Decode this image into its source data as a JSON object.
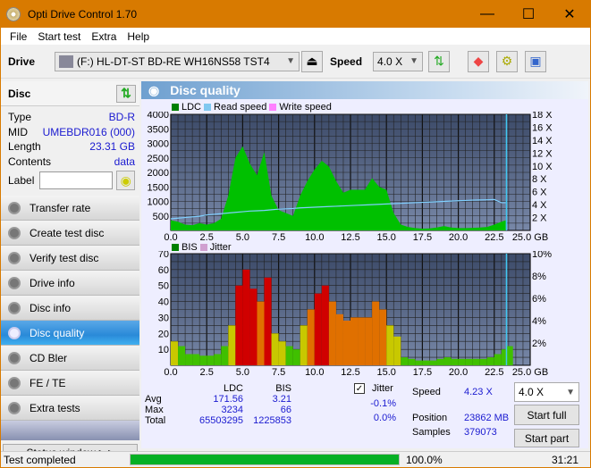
{
  "window": {
    "title": "Opti Drive Control 1.70",
    "min": "—",
    "max": "☐",
    "close": "✕"
  },
  "menu": [
    "File",
    "Start test",
    "Extra",
    "Help"
  ],
  "toolbar": {
    "drive_label": "Drive",
    "drive_value": "(F:)  HL-DT-ST BD-RE  WH16NS58 TST4",
    "speed_label": "Speed",
    "speed_value": "4.0 X"
  },
  "disc": {
    "header": "Disc",
    "rows": [
      {
        "k": "Type",
        "v": "BD-R"
      },
      {
        "k": "MID",
        "v": "UMEBDR016 (000)"
      },
      {
        "k": "Length",
        "v": "23.31 GB"
      },
      {
        "k": "Contents",
        "v": "data"
      }
    ],
    "label_key": "Label",
    "label_value": ""
  },
  "nav": [
    "Transfer rate",
    "Create test disc",
    "Verify test disc",
    "Drive info",
    "Disc info",
    "Disc quality",
    "CD Bler",
    "FE / TE",
    "Extra tests"
  ],
  "nav_active": 5,
  "status_window": "Status window > >",
  "main_title": "Disc quality",
  "chart_data": [
    {
      "type": "area",
      "title": "LDC",
      "legend": [
        "LDC",
        "Read speed",
        "Write speed"
      ],
      "legend_colors": [
        "#008000",
        "#80c8f0",
        "#ff80ff"
      ],
      "xlabel": "GB",
      "x_ticks": [
        "0.0",
        "2.5",
        "5.0",
        "7.5",
        "10.0",
        "12.5",
        "15.0",
        "17.5",
        "20.0",
        "22.5",
        "25.0 GB"
      ],
      "y_ticks": [
        "500",
        "1000",
        "1500",
        "2000",
        "2500",
        "3000",
        "3500",
        "4000"
      ],
      "y2_ticks": [
        "2 X",
        "4 X",
        "6 X",
        "8 X",
        "10 X",
        "12 X",
        "14 X",
        "16 X",
        "18 X"
      ],
      "xlim": [
        0,
        25
      ],
      "ylim": [
        0,
        4000
      ],
      "y2lim": [
        0,
        18
      ],
      "x": [
        0,
        0.5,
        1,
        1.5,
        2,
        2.5,
        3,
        3.5,
        4,
        4.5,
        5,
        5.5,
        6,
        6.5,
        7,
        7.5,
        8,
        8.5,
        9,
        9.5,
        10,
        10.5,
        11,
        11.5,
        12,
        12.5,
        13,
        13.5,
        14,
        14.5,
        15,
        15.5,
        16,
        16.5,
        17,
        17.5,
        18,
        18.5,
        19,
        19.5,
        20,
        20.5,
        21,
        21.5,
        22,
        22.5,
        23,
        23.3
      ],
      "ldc": [
        350,
        300,
        200,
        180,
        250,
        200,
        250,
        400,
        1200,
        2500,
        2900,
        2300,
        1900,
        2700,
        1200,
        700,
        600,
        500,
        1200,
        1700,
        2100,
        2400,
        2200,
        1700,
        1300,
        1400,
        1400,
        1400,
        1800,
        1500,
        1400,
        600,
        200,
        120,
        80,
        60,
        70,
        100,
        150,
        100,
        80,
        80,
        90,
        100,
        120,
        200,
        300,
        350
      ],
      "read_speed": [
        1.8,
        1.9,
        2.0,
        2.1,
        2.2,
        2.4,
        2.5,
        2.6,
        2.7,
        2.8,
        2.9,
        3.0,
        3.05,
        3.1,
        3.2,
        3.3,
        3.35,
        3.4,
        3.5,
        3.55,
        3.6,
        3.65,
        3.7,
        3.75,
        3.8,
        3.85,
        3.9,
        3.95,
        4.0,
        4.05,
        4.1,
        4.15,
        4.2,
        4.25,
        4.3,
        4.35,
        4.4,
        4.45,
        4.5,
        4.55,
        4.6,
        4.65,
        4.7,
        4.72,
        4.75,
        4.8,
        4.3,
        4.3
      ]
    },
    {
      "type": "bar",
      "title": "BIS",
      "legend": [
        "BIS",
        "Jitter"
      ],
      "legend_colors": [
        "#008000",
        "#d0a0d0"
      ],
      "xlabel": "GB",
      "x_ticks": [
        "0.0",
        "2.5",
        "5.0",
        "7.5",
        "10.0",
        "12.5",
        "15.0",
        "17.5",
        "20.0",
        "22.5",
        "25.0 GB"
      ],
      "y_ticks": [
        "10",
        "20",
        "30",
        "40",
        "50",
        "60",
        "70"
      ],
      "y2_ticks": [
        "2%",
        "4%",
        "6%",
        "8%",
        "10%"
      ],
      "xlim": [
        0,
        25
      ],
      "ylim": [
        0,
        70
      ],
      "y2lim": [
        0,
        10
      ],
      "x": [
        0,
        0.5,
        1,
        1.5,
        2,
        2.5,
        3,
        3.5,
        4,
        4.5,
        5,
        5.5,
        6,
        6.5,
        7,
        7.5,
        8,
        8.5,
        9,
        9.5,
        10,
        10.5,
        11,
        11.5,
        12,
        12.5,
        13,
        13.5,
        14,
        14.5,
        15,
        15.5,
        16,
        16.5,
        17,
        17.5,
        18,
        18.5,
        19,
        19.5,
        20,
        20.5,
        21,
        21.5,
        22,
        22.5,
        23,
        23.3
      ],
      "bis": [
        15,
        12,
        7,
        7,
        6,
        6,
        7,
        12,
        25,
        50,
        60,
        48,
        40,
        55,
        20,
        15,
        12,
        10,
        25,
        35,
        45,
        50,
        40,
        32,
        28,
        30,
        30,
        30,
        40,
        35,
        25,
        18,
        5,
        4,
        3,
        3,
        3,
        4,
        5,
        4,
        4,
        4,
        4,
        4,
        5,
        7,
        10,
        12
      ]
    }
  ],
  "stats": {
    "col_ldc": "LDC",
    "col_bis": "BIS",
    "rows": [
      {
        "k": "Avg",
        "ldc": "171.56",
        "bis": "3.21",
        "jit": "-0.1%"
      },
      {
        "k": "Max",
        "ldc": "3234",
        "bis": "66",
        "jit": "0.0%"
      },
      {
        "k": "Total",
        "ldc": "65503295",
        "bis": "1225853",
        "jit": ""
      }
    ],
    "jitter_label": "Jitter",
    "jitter_checked": true,
    "speed_label": "Speed",
    "speed_value": "4.23 X",
    "position_label": "Position",
    "position_value": "23862 MB",
    "samples_label": "Samples",
    "samples_value": "379073",
    "speed_select": "4.0 X",
    "start_full": "Start full",
    "start_part": "Start part"
  },
  "status": {
    "text": "Test completed",
    "progress": 100.0,
    "progress_text": "100.0%",
    "time": "31:21"
  }
}
